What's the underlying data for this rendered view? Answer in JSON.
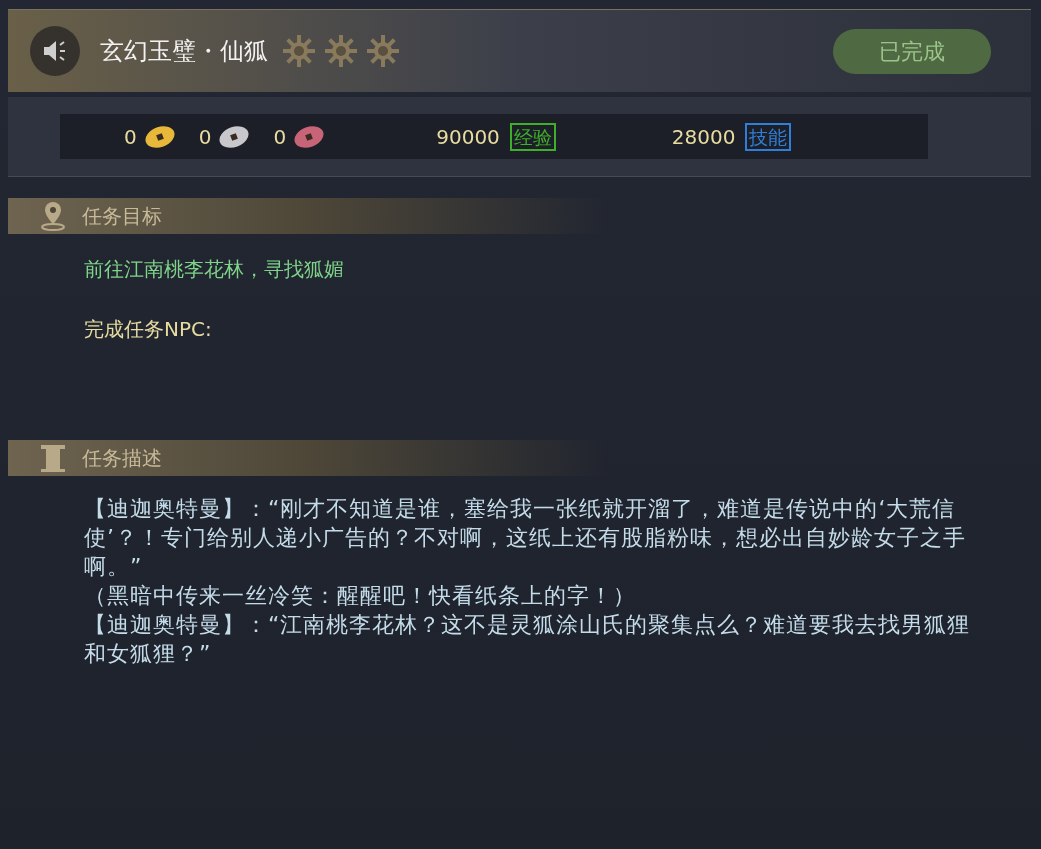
{
  "quest": {
    "title": "玄幻玉璧・仙狐",
    "stars": 3,
    "status": "已完成"
  },
  "rewards": {
    "currencies": [
      {
        "amount": "0",
        "color": "#e8b83a"
      },
      {
        "amount": "0",
        "color": "#c8c8cc"
      },
      {
        "amount": "0",
        "color": "#c86478"
      }
    ],
    "points": [
      {
        "amount": "90000",
        "tag": "经验",
        "color": "#3fae2a"
      },
      {
        "amount": "28000",
        "tag": "技能",
        "color": "#2f7fd8"
      }
    ]
  },
  "objective": {
    "heading": "任务目标",
    "goal": "前往江南桃李花林，寻找狐媚",
    "npc_label": "完成任务NPC:"
  },
  "description": {
    "heading": "任务描述",
    "paragraphs": [
      "【迪迦奥特曼】：“刚才不知道是谁，塞给我一张纸就开溜了，难道是传说中的‘大荒信使’？！专门给别人递小广告的？不对啊，这纸上还有股脂粉味，想必出自妙龄女子之手啊。”",
      "（黑暗中传来一丝冷笑：醒醒吧！快看纸条上的字！）",
      "【迪迦奥特曼】：“江南桃李花林？这不是灵狐涂山氏的聚集点么？难道要我去找男狐狸和女狐狸？”"
    ]
  }
}
